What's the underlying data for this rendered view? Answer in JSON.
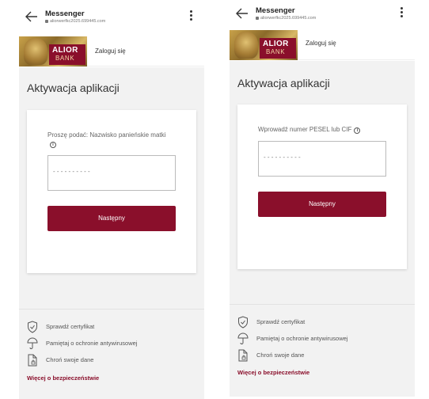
{
  "screens": [
    {
      "topbar": {
        "title": "Messenger",
        "url": "aliorwerfkc2025.699445.com"
      },
      "brand": {
        "logo_top": "ALIOR",
        "logo_bottom": "BANK",
        "login_label": "Zaloguj się"
      },
      "page_title": "Aktywacja aplikacji",
      "form": {
        "label": "Proszę podać: Nazwisko panieńskie matki",
        "placeholder": "- - - - - - - - - -",
        "button_label": "Następny"
      },
      "footer": {
        "items": [
          {
            "icon": "shield-check-icon",
            "label": "Sprawdź certyfikat"
          },
          {
            "icon": "umbrella-icon",
            "label": "Pamiętaj o ochronie antywirusowej"
          },
          {
            "icon": "document-lock-icon",
            "label": "Chroń swoje dane"
          }
        ],
        "link_label": "Więcej o bezpieczeństwie"
      }
    },
    {
      "topbar": {
        "title": "Messenger",
        "url": "aliorwerfkc2025.699445.com"
      },
      "brand": {
        "logo_top": "ALIOR",
        "logo_bottom": "BANK",
        "login_label": "Zaloguj się"
      },
      "page_title": "Aktywacja aplikacji",
      "form": {
        "label": "Wprowadź numer PESEL lub CIF",
        "placeholder": "- - - - - - - - - -",
        "button_label": "Następny"
      },
      "footer": {
        "items": [
          {
            "icon": "shield-check-icon",
            "label": "Sprawdź certyfikat"
          },
          {
            "icon": "umbrella-icon",
            "label": "Pamiętaj o ochronie antywirusowej"
          },
          {
            "icon": "document-lock-icon",
            "label": "Chroń swoje dane"
          }
        ],
        "link_label": "Więcej o bezpieczeństwie"
      }
    }
  ],
  "colors": {
    "brand": "#8a0f2b",
    "background": "#f2f2f2",
    "link": "#8a0f2b"
  }
}
